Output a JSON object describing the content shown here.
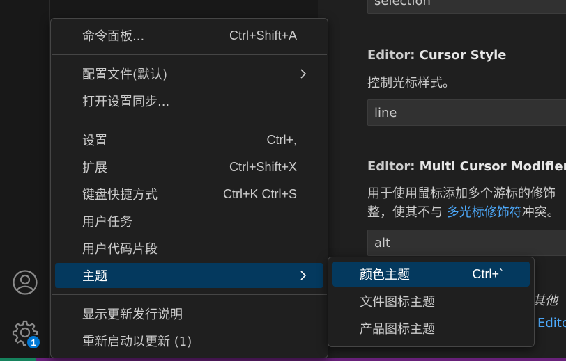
{
  "activity_bar": {
    "account_icon": "account-icon",
    "manage_icon": "gear-icon",
    "badge_count": "1"
  },
  "editor": {
    "top_value": "selection",
    "cursor_style": {
      "category": "Editor: ",
      "name": "Cursor Style",
      "description": "控制光标样式。",
      "value": "line"
    },
    "multi_cursor": {
      "category": "Editor: ",
      "name": "Multi Cursor Modifier",
      "description_line1": "用于使用鼠标添加多个游标的修饰",
      "description_line2_prefix": "整，使其不与 ",
      "description_link": "多光标修饰符",
      "description_line2_suffix": "冲突。",
      "value": "alt"
    },
    "partial_italic": "其他",
    "partial_link": "Edito"
  },
  "menu": {
    "items": [
      {
        "label": "命令面板...",
        "shortcut": "Ctrl+Shift+A"
      },
      {
        "label": "配置文件(默认)",
        "submenu": true
      },
      {
        "label": "打开设置同步..."
      },
      {
        "label": "设置",
        "shortcut": "Ctrl+,"
      },
      {
        "label": "扩展",
        "shortcut": "Ctrl+Shift+X"
      },
      {
        "label": "键盘快捷方式",
        "shortcut": "Ctrl+K Ctrl+S"
      },
      {
        "label": "用户任务"
      },
      {
        "label": "用户代码片段"
      },
      {
        "label": "主题",
        "submenu": true,
        "active": true
      },
      {
        "label": "显示更新发行说明"
      },
      {
        "label": "重新启动以更新 (1)"
      }
    ]
  },
  "submenu": {
    "items": [
      {
        "label": "颜色主题",
        "shortcut": "Ctrl+`",
        "active": true
      },
      {
        "label": "文件图标主题"
      },
      {
        "label": "产品图标主题"
      }
    ]
  },
  "colors": {
    "accent": "#0078d4",
    "active_item": "#04395e",
    "link": "#4daafc",
    "status_remote": "#16825d",
    "status_bar": "#68217a"
  }
}
